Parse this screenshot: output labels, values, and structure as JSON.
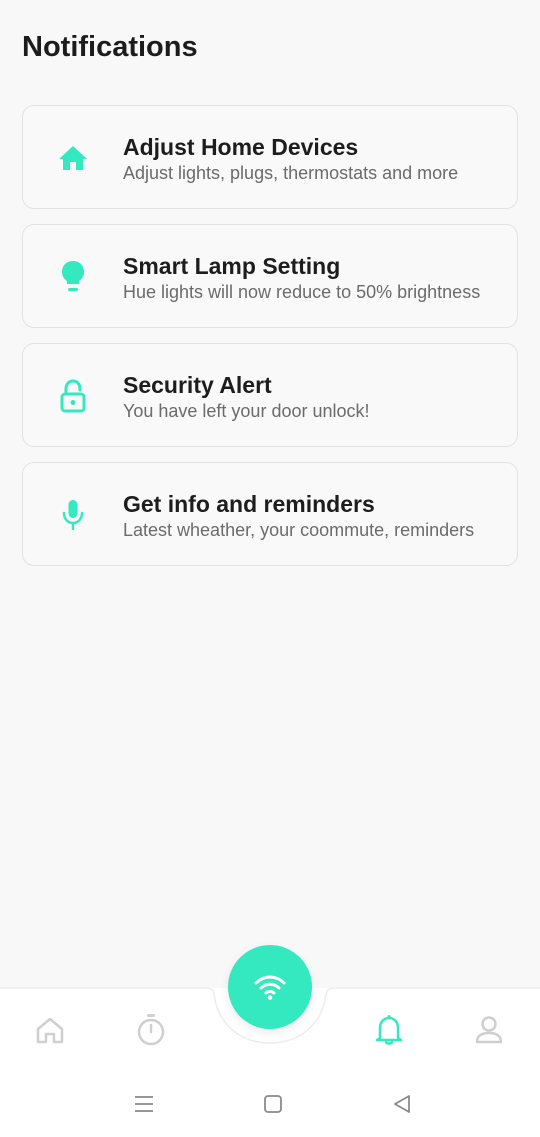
{
  "header": {
    "title": "Notifications"
  },
  "colors": {
    "accent": "#34e8c0",
    "inactive": "#cfcfcf",
    "text": "#1d1d1d",
    "subtext": "#6b6b6b"
  },
  "notifications": [
    {
      "icon": "home-icon",
      "title": "Adjust Home Devices",
      "subtitle": "Adjust lights, plugs, thermostats and more"
    },
    {
      "icon": "lightbulb-icon",
      "title": "Smart Lamp Setting",
      "subtitle": "Hue lights will now reduce to 50% brightness"
    },
    {
      "icon": "unlock-icon",
      "title": "Security Alert",
      "subtitle": "You have left your door unlock!"
    },
    {
      "icon": "microphone-icon",
      "title": "Get info and reminders",
      "subtitle": "Latest wheather, your coommute, reminders"
    }
  ],
  "bottom_nav": [
    {
      "icon": "home-outline-icon",
      "active": false
    },
    {
      "icon": "timer-icon",
      "active": false
    },
    {
      "icon": "wifi-icon",
      "active": false,
      "center": true
    },
    {
      "icon": "bell-icon",
      "active": true
    },
    {
      "icon": "profile-icon",
      "active": false
    }
  ],
  "system_nav": [
    "menu-icon",
    "home-square-icon",
    "back-icon"
  ]
}
